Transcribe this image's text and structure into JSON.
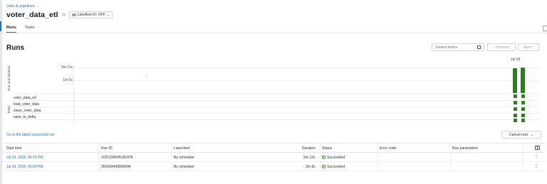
{
  "breadcrumb": {
    "label": "Jobs & pipelines",
    "separator": "›"
  },
  "job": {
    "title": "voter_data_etl",
    "lakeflow_label": "Lakeflow UI: OFF"
  },
  "tabs": [
    {
      "label": "Runs",
      "active": true
    },
    {
      "label": "Tasks",
      "active": false
    }
  ],
  "runs": {
    "heading": "Runs",
    "started_before_placeholder": "Started before",
    "previous_label": "Previous",
    "next_label": "Next",
    "y_axis_label": "Run total duration",
    "tasks_axis_label": "Tasks",
    "y_ticks": [
      "2m 11s",
      "1m 5s"
    ],
    "date_label": "Jul 03",
    "task_names": [
      "voter_data_etl",
      "load_voter_data",
      "clean_voter_data",
      "save_to_delta"
    ],
    "latest_successful_link": "Go to the latest successful run",
    "cancel_label": "Cancel runs"
  },
  "chart_data": {
    "type": "bar",
    "categories": [
      "Jul 03, 2025, 05:00 PM",
      "Jul 03, 2025, 05:15 PM"
    ],
    "series": [
      {
        "values": [
          128,
          132
        ]
      }
    ],
    "ylabel": "Run total duration",
    "yticks": [
      "1m 5s",
      "2m 11s"
    ],
    "ylim": [
      0,
      131
    ],
    "xlabel": "Jul 03"
  },
  "table": {
    "headers": {
      "start_time": "Start time",
      "run_id": "Run ID",
      "launched": "Launched",
      "duration": "Duration",
      "status": "Status",
      "error_code": "Error code",
      "run_parameters": "Run parameters"
    },
    "rows": [
      {
        "start_time": "Jul 03, 2025, 05:15 PM",
        "run_id": "1021334045181478",
        "launched": "By scheduler",
        "duration": "2m 12s",
        "status": "Succeeded"
      },
      {
        "start_time": "Jul 03, 2025, 05:00 PM",
        "run_id": "359354430890944",
        "launched": "By scheduler",
        "duration": "2m 8s",
        "status": "Succeeded"
      }
    ]
  },
  "colors": {
    "accent": "#2272b4",
    "success": "#2e7d1e"
  },
  "icons": {
    "star": "star-icon",
    "calendar": "calendar-icon",
    "check": "check-circle-icon",
    "kebab": "kebab-menu-icon",
    "columns": "columns-icon"
  }
}
